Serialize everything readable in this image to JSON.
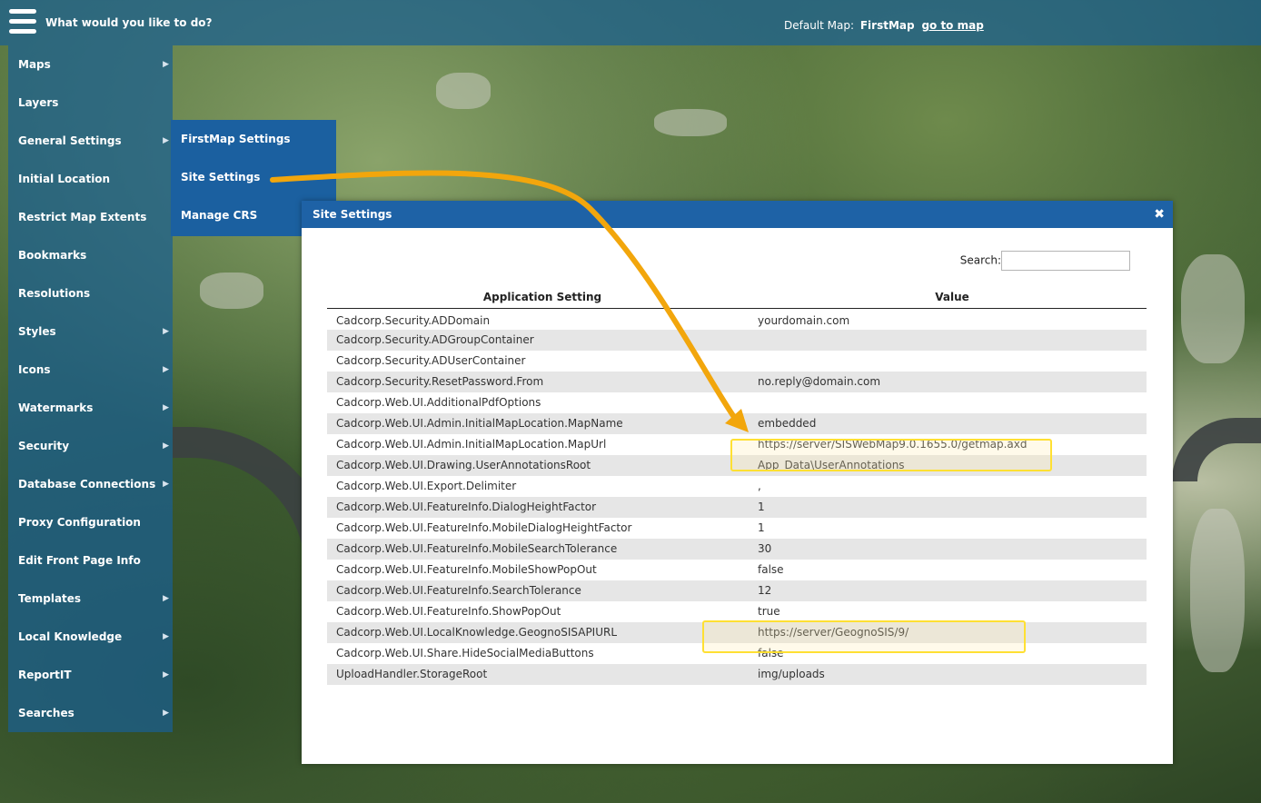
{
  "topbar": {
    "prompt": "What would you like to do?",
    "default_map_label": "Default Map:",
    "default_map_name": "FirstMap",
    "go_to_map": "go to map"
  },
  "sidebar": {
    "items": [
      {
        "label": "Maps",
        "has_sub": true
      },
      {
        "label": "Layers",
        "has_sub": false
      },
      {
        "label": "General Settings",
        "has_sub": true
      },
      {
        "label": "Initial Location",
        "has_sub": false
      },
      {
        "label": "Restrict Map Extents",
        "has_sub": false
      },
      {
        "label": "Bookmarks",
        "has_sub": false
      },
      {
        "label": "Resolutions",
        "has_sub": false
      },
      {
        "label": "Styles",
        "has_sub": true
      },
      {
        "label": "Icons",
        "has_sub": true
      },
      {
        "label": "Watermarks",
        "has_sub": true
      },
      {
        "label": "Security",
        "has_sub": true
      },
      {
        "label": "Database Connections",
        "has_sub": true
      },
      {
        "label": "Proxy Configuration",
        "has_sub": false
      },
      {
        "label": "Edit Front Page Info",
        "has_sub": false
      },
      {
        "label": "Templates",
        "has_sub": true
      },
      {
        "label": "Local Knowledge",
        "has_sub": true
      },
      {
        "label": "ReportIT",
        "has_sub": true
      },
      {
        "label": "Searches",
        "has_sub": true
      }
    ]
  },
  "submenu": {
    "items": [
      "FirstMap Settings",
      "Site Settings",
      "Manage CRS"
    ]
  },
  "dialog": {
    "title": "Site Settings",
    "close_icon": "close-icon",
    "search_label": "Search:",
    "search_value": "",
    "columns": [
      "Application Setting",
      "Value"
    ],
    "rows": [
      [
        "Cadcorp.Security.ADDomain",
        "yourdomain.com"
      ],
      [
        "Cadcorp.Security.ADGroupContainer",
        ""
      ],
      [
        "Cadcorp.Security.ADUserContainer",
        ""
      ],
      [
        "Cadcorp.Security.ResetPassword.From",
        "no.reply@domain.com"
      ],
      [
        "Cadcorp.Web.UI.AdditionalPdfOptions",
        ""
      ],
      [
        "Cadcorp.Web.UI.Admin.InitialMapLocation.MapName",
        "embedded"
      ],
      [
        "Cadcorp.Web.UI.Admin.InitialMapLocation.MapUrl",
        "https://server/SISWebMap9.0.1655.0/getmap.axd"
      ],
      [
        "Cadcorp.Web.UI.Drawing.UserAnnotationsRoot",
        "App_Data\\UserAnnotations"
      ],
      [
        "Cadcorp.Web.UI.Export.Delimiter",
        ","
      ],
      [
        "Cadcorp.Web.UI.FeatureInfo.DialogHeightFactor",
        "1"
      ],
      [
        "Cadcorp.Web.UI.FeatureInfo.MobileDialogHeightFactor",
        "1"
      ],
      [
        "Cadcorp.Web.UI.FeatureInfo.MobileSearchTolerance",
        "30"
      ],
      [
        "Cadcorp.Web.UI.FeatureInfo.MobileShowPopOut",
        "false"
      ],
      [
        "Cadcorp.Web.UI.FeatureInfo.SearchTolerance",
        "12"
      ],
      [
        "Cadcorp.Web.UI.FeatureInfo.ShowPopOut",
        "true"
      ],
      [
        "Cadcorp.Web.UI.LocalKnowledge.GeognoSISAPIURL",
        "https://server/GeognoSIS/9/"
      ],
      [
        "Cadcorp.Web.UI.Share.HideSocialMediaButtons",
        "false"
      ],
      [
        "UploadHandler.StorageRoot",
        "img/uploads"
      ]
    ]
  },
  "colors": {
    "header_blue": "#1e62a6",
    "callout_arrow": "#f2a60c",
    "highlight": "#ffe033"
  }
}
